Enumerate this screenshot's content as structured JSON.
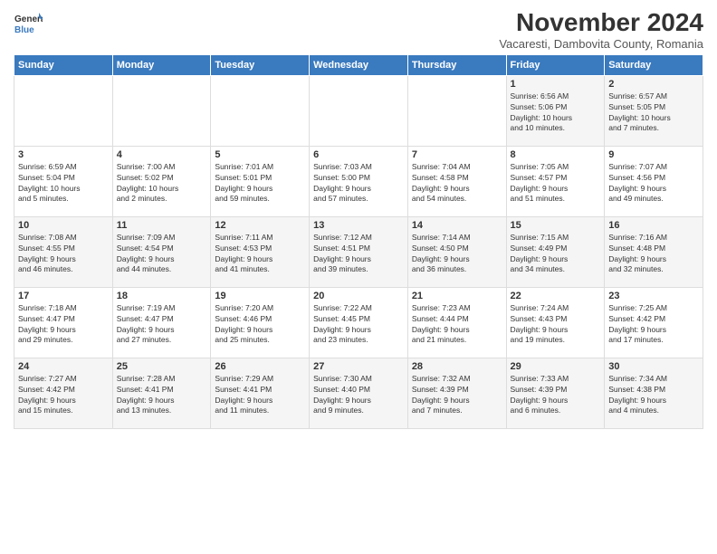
{
  "logo": {
    "line1": "General",
    "line2": "Blue"
  },
  "title": "November 2024",
  "location": "Vacaresti, Dambovita County, Romania",
  "headers": [
    "Sunday",
    "Monday",
    "Tuesday",
    "Wednesday",
    "Thursday",
    "Friday",
    "Saturday"
  ],
  "weeks": [
    [
      {
        "day": "",
        "info": ""
      },
      {
        "day": "",
        "info": ""
      },
      {
        "day": "",
        "info": ""
      },
      {
        "day": "",
        "info": ""
      },
      {
        "day": "",
        "info": ""
      },
      {
        "day": "1",
        "info": "Sunrise: 6:56 AM\nSunset: 5:06 PM\nDaylight: 10 hours\nand 10 minutes."
      },
      {
        "day": "2",
        "info": "Sunrise: 6:57 AM\nSunset: 5:05 PM\nDaylight: 10 hours\nand 7 minutes."
      }
    ],
    [
      {
        "day": "3",
        "info": "Sunrise: 6:59 AM\nSunset: 5:04 PM\nDaylight: 10 hours\nand 5 minutes."
      },
      {
        "day": "4",
        "info": "Sunrise: 7:00 AM\nSunset: 5:02 PM\nDaylight: 10 hours\nand 2 minutes."
      },
      {
        "day": "5",
        "info": "Sunrise: 7:01 AM\nSunset: 5:01 PM\nDaylight: 9 hours\nand 59 minutes."
      },
      {
        "day": "6",
        "info": "Sunrise: 7:03 AM\nSunset: 5:00 PM\nDaylight: 9 hours\nand 57 minutes."
      },
      {
        "day": "7",
        "info": "Sunrise: 7:04 AM\nSunset: 4:58 PM\nDaylight: 9 hours\nand 54 minutes."
      },
      {
        "day": "8",
        "info": "Sunrise: 7:05 AM\nSunset: 4:57 PM\nDaylight: 9 hours\nand 51 minutes."
      },
      {
        "day": "9",
        "info": "Sunrise: 7:07 AM\nSunset: 4:56 PM\nDaylight: 9 hours\nand 49 minutes."
      }
    ],
    [
      {
        "day": "10",
        "info": "Sunrise: 7:08 AM\nSunset: 4:55 PM\nDaylight: 9 hours\nand 46 minutes."
      },
      {
        "day": "11",
        "info": "Sunrise: 7:09 AM\nSunset: 4:54 PM\nDaylight: 9 hours\nand 44 minutes."
      },
      {
        "day": "12",
        "info": "Sunrise: 7:11 AM\nSunset: 4:53 PM\nDaylight: 9 hours\nand 41 minutes."
      },
      {
        "day": "13",
        "info": "Sunrise: 7:12 AM\nSunset: 4:51 PM\nDaylight: 9 hours\nand 39 minutes."
      },
      {
        "day": "14",
        "info": "Sunrise: 7:14 AM\nSunset: 4:50 PM\nDaylight: 9 hours\nand 36 minutes."
      },
      {
        "day": "15",
        "info": "Sunrise: 7:15 AM\nSunset: 4:49 PM\nDaylight: 9 hours\nand 34 minutes."
      },
      {
        "day": "16",
        "info": "Sunrise: 7:16 AM\nSunset: 4:48 PM\nDaylight: 9 hours\nand 32 minutes."
      }
    ],
    [
      {
        "day": "17",
        "info": "Sunrise: 7:18 AM\nSunset: 4:47 PM\nDaylight: 9 hours\nand 29 minutes."
      },
      {
        "day": "18",
        "info": "Sunrise: 7:19 AM\nSunset: 4:47 PM\nDaylight: 9 hours\nand 27 minutes."
      },
      {
        "day": "19",
        "info": "Sunrise: 7:20 AM\nSunset: 4:46 PM\nDaylight: 9 hours\nand 25 minutes."
      },
      {
        "day": "20",
        "info": "Sunrise: 7:22 AM\nSunset: 4:45 PM\nDaylight: 9 hours\nand 23 minutes."
      },
      {
        "day": "21",
        "info": "Sunrise: 7:23 AM\nSunset: 4:44 PM\nDaylight: 9 hours\nand 21 minutes."
      },
      {
        "day": "22",
        "info": "Sunrise: 7:24 AM\nSunset: 4:43 PM\nDaylight: 9 hours\nand 19 minutes."
      },
      {
        "day": "23",
        "info": "Sunrise: 7:25 AM\nSunset: 4:42 PM\nDaylight: 9 hours\nand 17 minutes."
      }
    ],
    [
      {
        "day": "24",
        "info": "Sunrise: 7:27 AM\nSunset: 4:42 PM\nDaylight: 9 hours\nand 15 minutes."
      },
      {
        "day": "25",
        "info": "Sunrise: 7:28 AM\nSunset: 4:41 PM\nDaylight: 9 hours\nand 13 minutes."
      },
      {
        "day": "26",
        "info": "Sunrise: 7:29 AM\nSunset: 4:41 PM\nDaylight: 9 hours\nand 11 minutes."
      },
      {
        "day": "27",
        "info": "Sunrise: 7:30 AM\nSunset: 4:40 PM\nDaylight: 9 hours\nand 9 minutes."
      },
      {
        "day": "28",
        "info": "Sunrise: 7:32 AM\nSunset: 4:39 PM\nDaylight: 9 hours\nand 7 minutes."
      },
      {
        "day": "29",
        "info": "Sunrise: 7:33 AM\nSunset: 4:39 PM\nDaylight: 9 hours\nand 6 minutes."
      },
      {
        "day": "30",
        "info": "Sunrise: 7:34 AM\nSunset: 4:38 PM\nDaylight: 9 hours\nand 4 minutes."
      }
    ]
  ]
}
